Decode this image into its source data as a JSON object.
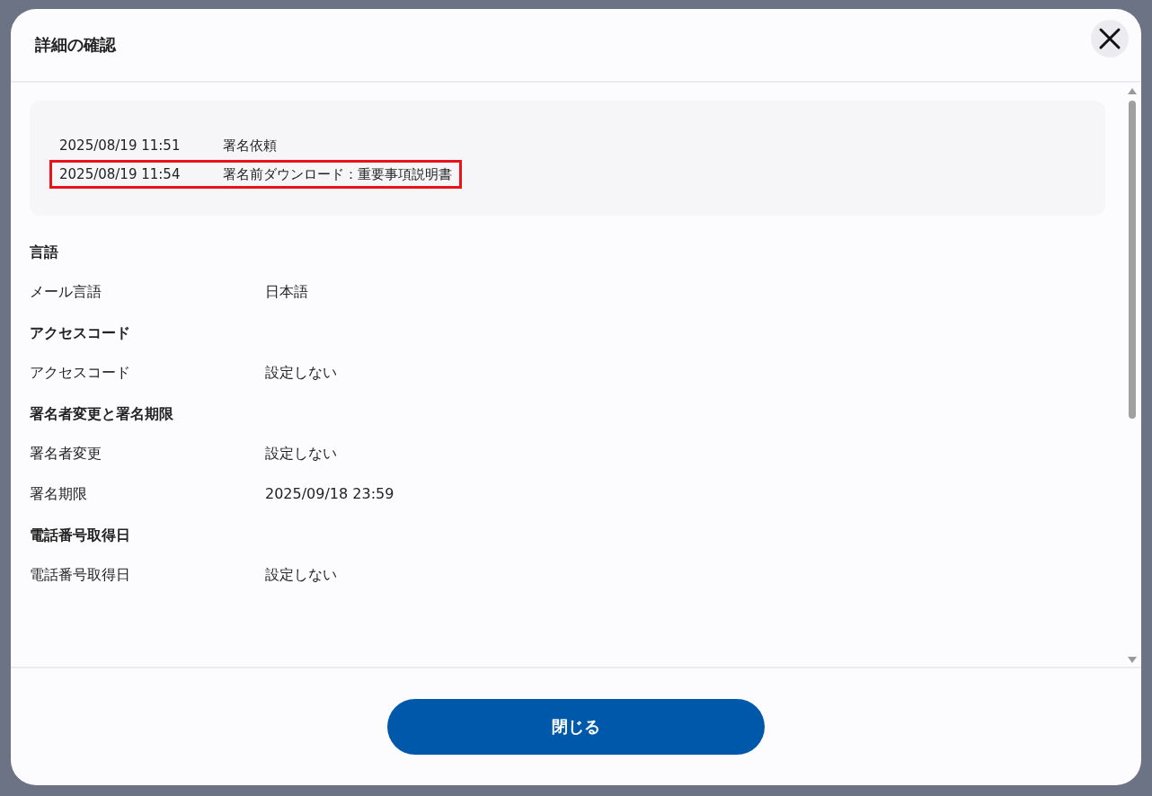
{
  "dialog": {
    "title": "詳細の確認"
  },
  "log": [
    {
      "time": "2025/08/19 11:51",
      "event": "署名依頼",
      "highlighted": false
    },
    {
      "time": "2025/08/19 11:54",
      "event": "署名前ダウンロード：重要事項説明書",
      "highlighted": true
    }
  ],
  "sections": [
    {
      "heading": "言語",
      "rows": [
        {
          "label": "メール言語",
          "value": "日本語"
        }
      ]
    },
    {
      "heading": "アクセスコード",
      "rows": [
        {
          "label": "アクセスコード",
          "value": "設定しない"
        }
      ]
    },
    {
      "heading": "署名者変更と署名期限",
      "rows": [
        {
          "label": "署名者変更",
          "value": "設定しない"
        },
        {
          "label": "署名期限",
          "value": "2025/09/18 23:59"
        }
      ]
    },
    {
      "heading": "電話番号取得日",
      "rows": [
        {
          "label": "電話番号取得日",
          "value": "設定しない"
        }
      ]
    }
  ],
  "footer": {
    "button": "閉じる"
  }
}
